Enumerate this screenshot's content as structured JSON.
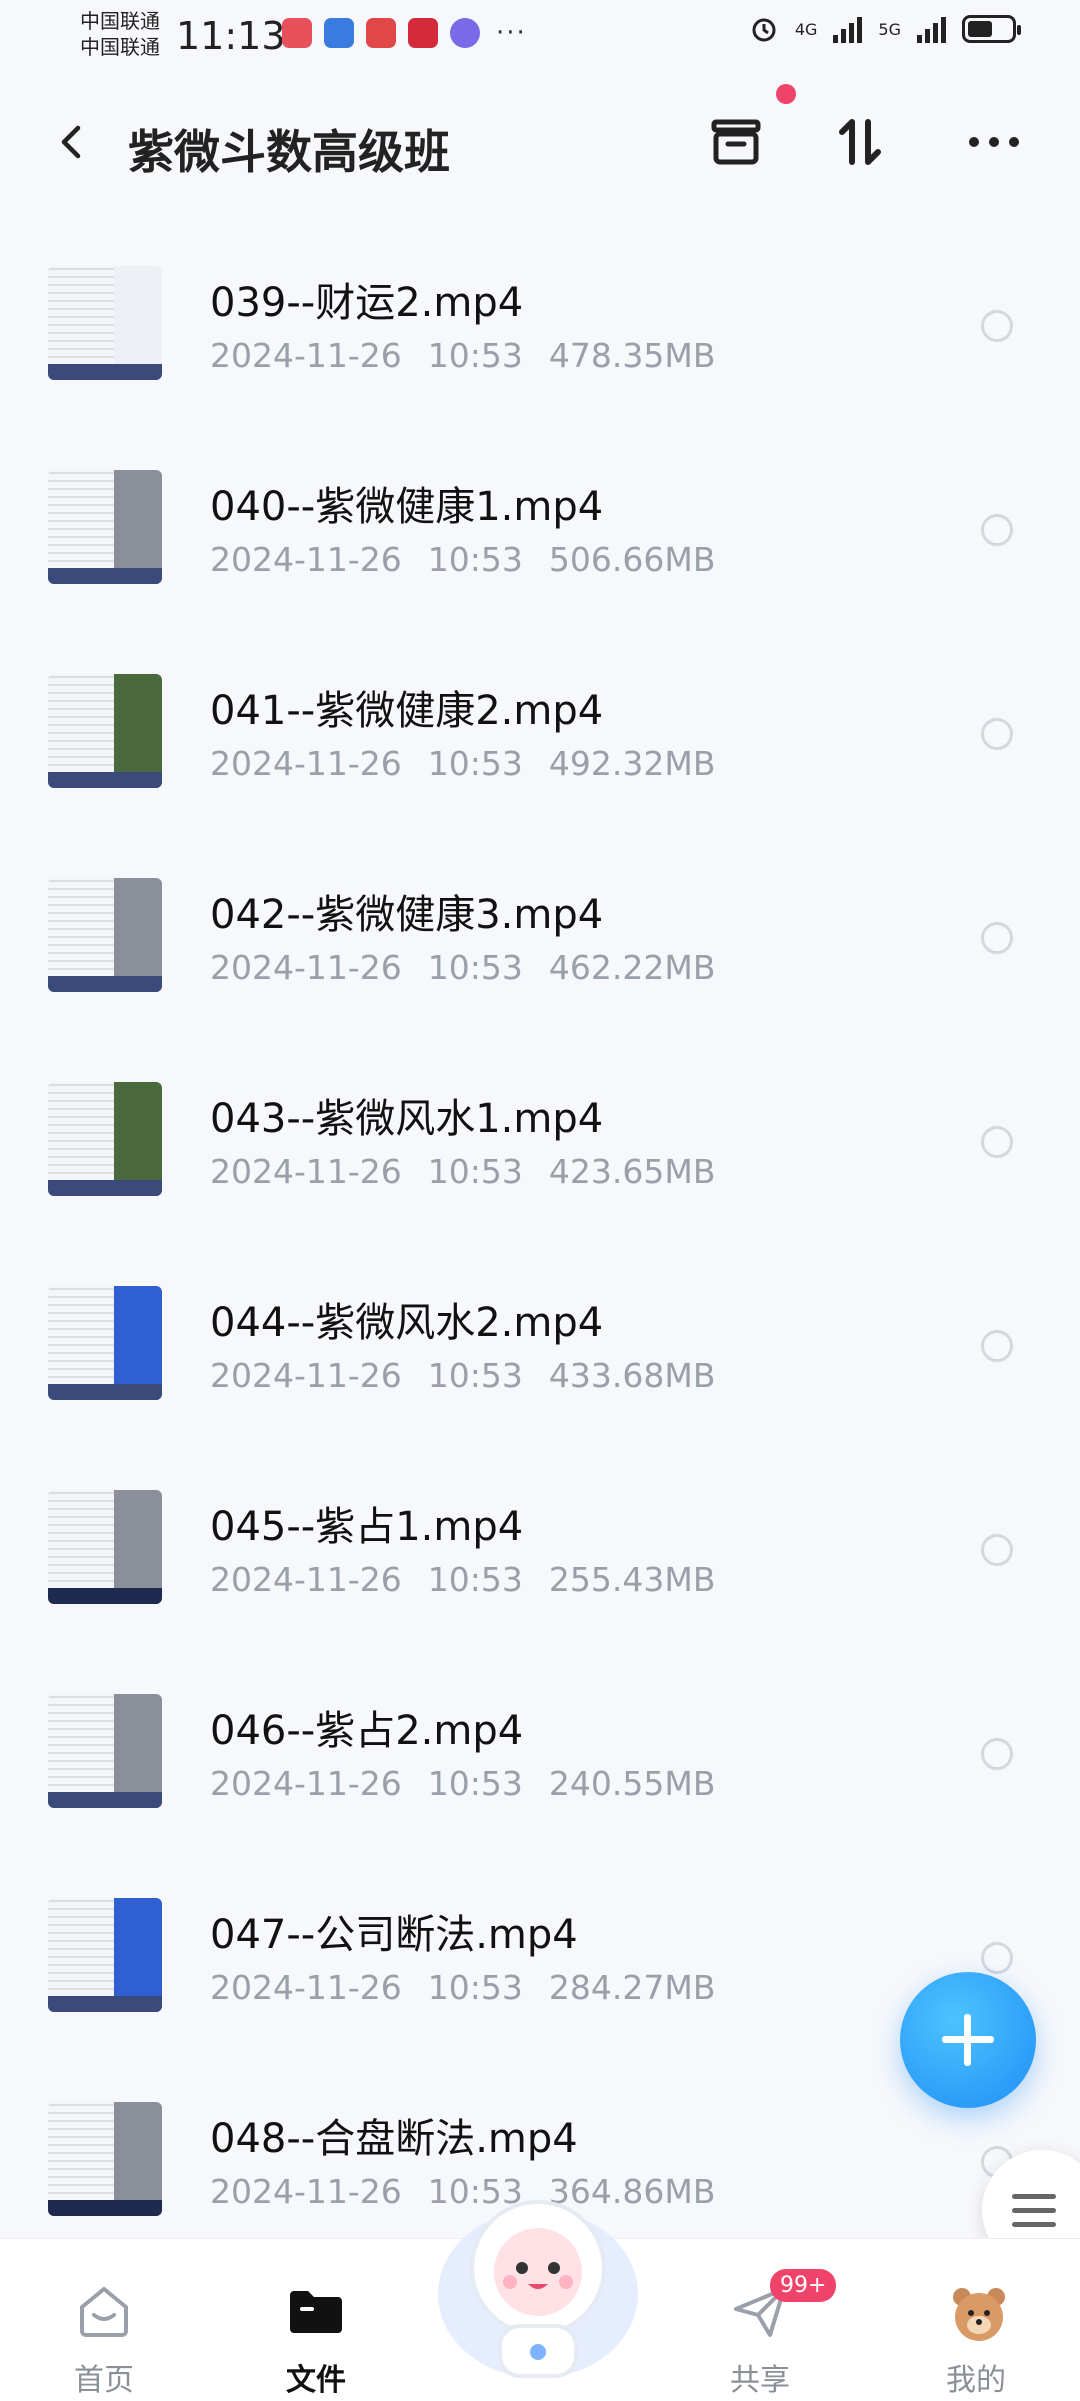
{
  "status_bar": {
    "carrier1": "中国联通",
    "carrier2": "中国联通",
    "time": "11:13",
    "net1": "4G",
    "net2": "5G"
  },
  "header": {
    "title": "紫微斗数高级班"
  },
  "files": [
    {
      "name": "039--财运2.mp4",
      "date": "2024-11-26",
      "time": "10:53",
      "size": "478.35MB"
    },
    {
      "name": "040--紫微健康1.mp4",
      "date": "2024-11-26",
      "time": "10:53",
      "size": "506.66MB"
    },
    {
      "name": "041--紫微健康2.mp4",
      "date": "2024-11-26",
      "time": "10:53",
      "size": "492.32MB"
    },
    {
      "name": "042--紫微健康3.mp4",
      "date": "2024-11-26",
      "time": "10:53",
      "size": "462.22MB"
    },
    {
      "name": "043--紫微风水1.mp4",
      "date": "2024-11-26",
      "time": "10:53",
      "size": "423.65MB"
    },
    {
      "name": "044--紫微风水2.mp4",
      "date": "2024-11-26",
      "time": "10:53",
      "size": "433.68MB"
    },
    {
      "name": "045--紫占1.mp4",
      "date": "2024-11-26",
      "time": "10:53",
      "size": "255.43MB"
    },
    {
      "name": "046--紫占2.mp4",
      "date": "2024-11-26",
      "time": "10:53",
      "size": "240.55MB"
    },
    {
      "name": "047--公司断法.mp4",
      "date": "2024-11-26",
      "time": "10:53",
      "size": "284.27MB"
    },
    {
      "name": "048--合盘断法.mp4",
      "date": "2024-11-26",
      "time": "10:53",
      "size": "364.86MB"
    }
  ],
  "tabbar": {
    "tabs": [
      {
        "label": "首页",
        "icon": "home-icon"
      },
      {
        "label": "文件",
        "icon": "folder-icon",
        "active": true
      },
      {
        "label": "共享",
        "icon": "paper-plane-icon",
        "badge": "99+"
      },
      {
        "label": "我的",
        "icon": "bear-avatar-icon"
      }
    ]
  },
  "colors": {
    "accent": "#1f8ef5",
    "badge": "#f0436a",
    "meta_text": "#9aa0aa"
  }
}
